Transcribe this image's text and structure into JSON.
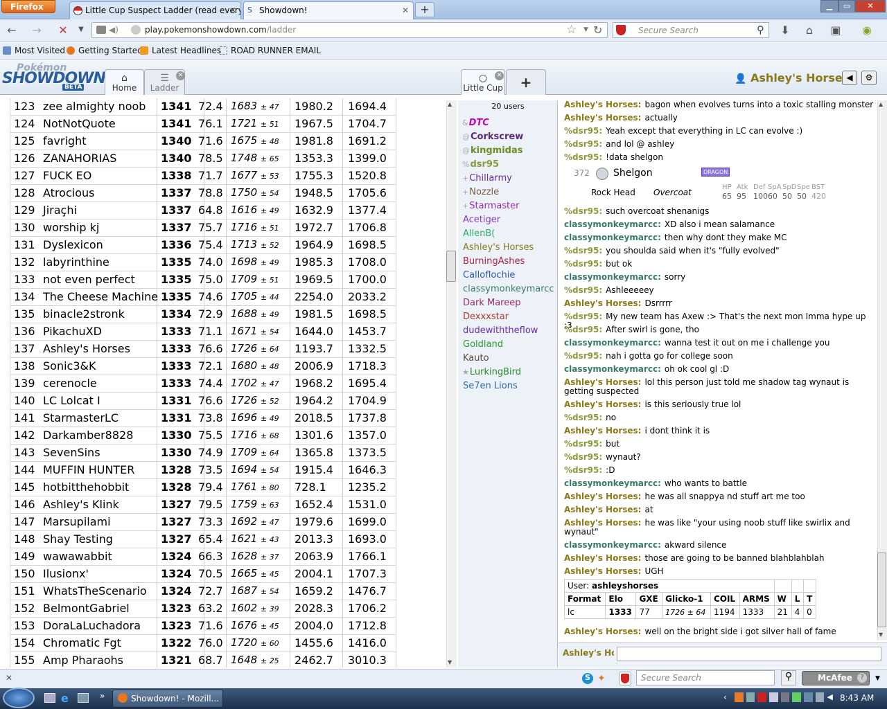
{
  "browser": {
    "menu": "Firefox",
    "tabs": [
      {
        "title": "Little Cup Suspect Ladder (read every..."
      },
      {
        "title": "Showdown!"
      }
    ],
    "url_domain": "play.pokemonshowdown.com",
    "url_path": "/ladder",
    "search_placeholder": "Secure Search",
    "bookmarks": [
      "Most Visited",
      "Getting Started",
      "Latest Headlines",
      "ROAD RUNNER EMAIL"
    ],
    "addon_search_placeholder": "Secure Search",
    "addon_label": "McAfee"
  },
  "app": {
    "logo_top": "Pokémon",
    "logo_main": "SHOWDOWN",
    "logo_badge": "BETA",
    "tabs": [
      {
        "label": "Home"
      },
      {
        "label": "Ladder"
      },
      {
        "label": "Little Cup"
      }
    ],
    "add_tab": "+",
    "username": "Ashley's Horses"
  },
  "ladder": {
    "rows": [
      [
        "123",
        "zee almighty noob",
        "1341",
        "72.4",
        "1683",
        "47",
        "1980.2",
        "1694.4"
      ],
      [
        "124",
        "NotNotQuote",
        "1341",
        "76.1",
        "1721",
        "51",
        "1967.5",
        "1704.7"
      ],
      [
        "125",
        "favright",
        "1340",
        "71.6",
        "1675",
        "48",
        "1981.8",
        "1691.2"
      ],
      [
        "126",
        "ZANAHORIAS",
        "1340",
        "78.5",
        "1748",
        "65",
        "1353.3",
        "1399.0"
      ],
      [
        "127",
        "FUCK EO",
        "1338",
        "71.7",
        "1677",
        "53",
        "1755.3",
        "1520.8"
      ],
      [
        "128",
        "Atrocious",
        "1337",
        "78.8",
        "1750",
        "54",
        "1948.5",
        "1705.6"
      ],
      [
        "129",
        "Jiraçhi",
        "1337",
        "64.8",
        "1616",
        "49",
        "1632.9",
        "1377.4"
      ],
      [
        "130",
        "worship kj",
        "1337",
        "75.7",
        "1716",
        "51",
        "1972.7",
        "1706.8"
      ],
      [
        "131",
        "Dyslexicon",
        "1336",
        "75.4",
        "1713",
        "52",
        "1964.9",
        "1698.5"
      ],
      [
        "132",
        "labyrinthine",
        "1335",
        "74.0",
        "1698",
        "49",
        "1985.3",
        "1708.0"
      ],
      [
        "133",
        "not even perfect",
        "1335",
        "75.0",
        "1709",
        "51",
        "1969.5",
        "1700.0"
      ],
      [
        "134",
        "The Cheese Machine",
        "1335",
        "74.6",
        "1705",
        "44",
        "2254.0",
        "2033.2"
      ],
      [
        "135",
        "binacle2stronk",
        "1334",
        "72.9",
        "1688",
        "49",
        "1981.5",
        "1698.5"
      ],
      [
        "136",
        "PikachuXD",
        "1333",
        "71.1",
        "1671",
        "54",
        "1644.0",
        "1453.7"
      ],
      [
        "137",
        "Ashley's Horses",
        "1333",
        "76.6",
        "1726",
        "64",
        "1193.7",
        "1332.5"
      ],
      [
        "138",
        "Sonic3&K",
        "1333",
        "72.1",
        "1680",
        "48",
        "2006.9",
        "1718.3"
      ],
      [
        "139",
        "cerenocle",
        "1333",
        "74.4",
        "1702",
        "47",
        "1968.2",
        "1695.4"
      ],
      [
        "140",
        "LC Lolcat I",
        "1331",
        "76.6",
        "1726",
        "52",
        "1964.2",
        "1704.9"
      ],
      [
        "141",
        "StarmasterLC",
        "1331",
        "73.8",
        "1696",
        "49",
        "2018.5",
        "1737.8"
      ],
      [
        "142",
        "Darkamber8828",
        "1330",
        "75.5",
        "1716",
        "68",
        "1301.6",
        "1357.0"
      ],
      [
        "143",
        "SevenSins",
        "1330",
        "74.9",
        "1709",
        "64",
        "1365.8",
        "1373.5"
      ],
      [
        "144",
        "MUFFIN HUNTER",
        "1328",
        "73.5",
        "1694",
        "54",
        "1915.4",
        "1646.3"
      ],
      [
        "145",
        "hotbitthehobbit",
        "1328",
        "79.4",
        "1761",
        "80",
        "728.1",
        "1235.2"
      ],
      [
        "146",
        "Ashley's Klink",
        "1327",
        "79.5",
        "1759",
        "63",
        "1652.4",
        "1531.0"
      ],
      [
        "147",
        "Marsupilami",
        "1327",
        "73.3",
        "1692",
        "47",
        "1979.6",
        "1699.0"
      ],
      [
        "148",
        "Shay Testing",
        "1327",
        "65.4",
        "1621",
        "43",
        "2013.3",
        "1693.0"
      ],
      [
        "149",
        "wawawabbit",
        "1324",
        "66.3",
        "1628",
        "37",
        "2063.9",
        "1766.1"
      ],
      [
        "150",
        "Ilusionx'",
        "1324",
        "70.5",
        "1665",
        "45",
        "2004.1",
        "1707.3"
      ],
      [
        "151",
        "WhatsTheScenario",
        "1324",
        "72.7",
        "1687",
        "54",
        "1659.2",
        "1476.7"
      ],
      [
        "152",
        "BelmontGabriel",
        "1323",
        "63.2",
        "1602",
        "39",
        "2028.3",
        "1706.2"
      ],
      [
        "153",
        "DoraLaLuchadora",
        "1323",
        "71.6",
        "1676",
        "45",
        "2004.0",
        "1712.8"
      ],
      [
        "154",
        "Chromatic Fgt",
        "1322",
        "76.0",
        "1720",
        "60",
        "1455.6",
        "1416.0"
      ],
      [
        "155",
        "Amp Pharaohs",
        "1321",
        "68.7",
        "1648",
        "25",
        "2462.7",
        "3010.3"
      ]
    ],
    "pm": "±"
  },
  "userlist": {
    "count": "20 users",
    "users": [
      {
        "sym": "&",
        "name": "DTC",
        "color": "#c800c8",
        "style": "bi"
      },
      {
        "sym": "@",
        "name": "Corkscrew",
        "color": "#5a2a7a",
        "style": "b"
      },
      {
        "sym": "@",
        "name": "kingmidas",
        "color": "#6b8e23",
        "style": "b"
      },
      {
        "sym": "%",
        "name": "dsr95",
        "color": "#8a9a3a",
        "style": "b"
      },
      {
        "sym": "+",
        "name": "Chillarmy",
        "color": "#6a2a9a",
        "style": ""
      },
      {
        "sym": "+",
        "name": "Nozzle",
        "color": "#7a5a3a",
        "style": ""
      },
      {
        "sym": "+",
        "name": "Starmaster",
        "color": "#9a2ab0",
        "style": ""
      },
      {
        "sym": "",
        "name": "Acetiger",
        "color": "#8a3ac0",
        "style": ""
      },
      {
        "sym": "",
        "name": "AllenB(",
        "color": "#2ab06a",
        "style": ""
      },
      {
        "sym": "",
        "name": "Ashley's Horses",
        "color": "#8c7a1a",
        "style": ""
      },
      {
        "sym": "",
        "name": "BurningAshes",
        "color": "#b0204a",
        "style": ""
      },
      {
        "sym": "",
        "name": "Calloflochie",
        "color": "#2a5ab0",
        "style": ""
      },
      {
        "sym": "",
        "name": "classymonkeymarcc",
        "color": "#3a7a6a",
        "style": ""
      },
      {
        "sym": "",
        "name": "Dark Mareep",
        "color": "#9a2a6a",
        "style": ""
      },
      {
        "sym": "",
        "name": "Dexxxstar",
        "color": "#b03a2a",
        "style": ""
      },
      {
        "sym": "",
        "name": "dudewiththeflow",
        "color": "#6a2ab0",
        "style": ""
      },
      {
        "sym": "",
        "name": "Goldland",
        "color": "#2a9a2a",
        "style": ""
      },
      {
        "sym": "",
        "name": "Kauto",
        "color": "#5a4a3a",
        "style": ""
      },
      {
        "sym": "★",
        "name": "LurkingBird",
        "color": "#2a8a2a",
        "style": ""
      },
      {
        "sym": "",
        "name": "Se7en Lions",
        "color": "#2a6ab0",
        "style": ""
      }
    ]
  },
  "chat": {
    "messages": [
      {
        "name": "Ashley's Horses:",
        "text": "bagon when evolves turns into a toxic stalling monster",
        "color": "#8c7a1a"
      },
      {
        "name": "Ashley's Horses:",
        "text": "actually",
        "color": "#8c7a1a"
      },
      {
        "name": "%dsr95:",
        "text": "Yeah except that everything in LC can evolve :)",
        "color": "#8a9a3a"
      },
      {
        "name": "%dsr95:",
        "text": "and lol @ ashley",
        "color": "#8a9a3a"
      },
      {
        "name": "%dsr95:",
        "text": "!data shelgon",
        "color": "#8a9a3a"
      },
      {
        "name": "%dsr95:",
        "text": "such overcoat shenanigs",
        "color": "#8a9a3a"
      },
      {
        "name": "classymonkeymarcc:",
        "text": "XD also i mean salamance",
        "color": "#3a7a6a"
      },
      {
        "name": "classymonkeymarcc:",
        "text": "then why dont they make MC",
        "color": "#3a7a6a"
      },
      {
        "name": "%dsr95:",
        "text": "you shoulda said when it's \"fully evolved\"",
        "color": "#8a9a3a"
      },
      {
        "name": "%dsr95:",
        "text": "but ok",
        "color": "#8a9a3a"
      },
      {
        "name": "classymonkeymarcc:",
        "text": "sorry",
        "color": "#3a7a6a"
      },
      {
        "name": "%dsr95:",
        "text": "Ashleeeeey",
        "color": "#8a9a3a"
      },
      {
        "name": "Ashley's Horses:",
        "text": "Dsrrrrr",
        "color": "#8c7a1a"
      },
      {
        "name": "%dsr95:",
        "text": "My new team has Axew :> That's the next mon Imma hype up :3",
        "color": "#8a9a3a"
      },
      {
        "name": "%dsr95:",
        "text": "After swirl is gone, tho",
        "color": "#8a9a3a"
      },
      {
        "name": "classymonkeymarcc:",
        "text": "wanna test it out on me i challenge you",
        "color": "#3a7a6a"
      },
      {
        "name": "%dsr95:",
        "text": "nah i gotta go for college soon",
        "color": "#8a9a3a"
      },
      {
        "name": "classymonkeymarcc:",
        "text": "oh ok cool gl :D",
        "color": "#3a7a6a"
      },
      {
        "name": "Ashley's Horses:",
        "text": "lol this person just told me shadow tag wynaut is getting suspected",
        "color": "#8c7a1a"
      },
      {
        "name": "Ashley's Horses:",
        "text": "is this seriously true lol",
        "color": "#8c7a1a"
      },
      {
        "name": "%dsr95:",
        "text": "no",
        "color": "#8a9a3a"
      },
      {
        "name": "Ashley's Horses:",
        "text": "i dont think it is",
        "color": "#8c7a1a"
      },
      {
        "name": "%dsr95:",
        "text": "but",
        "color": "#8a9a3a"
      },
      {
        "name": "%dsr95:",
        "text": "wynaut?",
        "color": "#8a9a3a"
      },
      {
        "name": "%dsr95:",
        "text": ":D",
        "color": "#8a9a3a"
      },
      {
        "name": "classymonkeymarcc:",
        "text": "who wants to battle",
        "color": "#3a7a6a"
      },
      {
        "name": "Ashley's Horses:",
        "text": "he was all snappya nd stuff art me too",
        "color": "#8c7a1a"
      },
      {
        "name": "Ashley's Horses:",
        "text": "at",
        "color": "#8c7a1a"
      },
      {
        "name": "Ashley's Horses:",
        "text": "he was like \"your using noob stuff like swirlix and wynaut\"",
        "color": "#8c7a1a"
      },
      {
        "name": "classymonkeymarcc:",
        "text": "akward silence",
        "color": "#3a7a6a"
      },
      {
        "name": "Ashley's Horses:",
        "text": "those are going to be banned blahblahblah",
        "color": "#8c7a1a"
      },
      {
        "name": "Ashley's Horses:",
        "text": "UGH",
        "color": "#8c7a1a"
      },
      {
        "name": "Ashley's Horses:",
        "text": "well on the bright side i got silver hall of fame",
        "color": "#8c7a1a"
      }
    ],
    "datacard": {
      "num": "372",
      "pokemon": "Shelgon",
      "type": "DRAGON",
      "ability": "Rock Head",
      "ability2": "Overcoat",
      "stat_labels": [
        "HP",
        "Atk",
        "Def",
        "SpA",
        "SpD",
        "Spe",
        "BST"
      ],
      "stat_values": [
        "65",
        "95",
        "100",
        "60",
        "50",
        "50",
        "420"
      ]
    },
    "userinfo": {
      "label": "User:",
      "user": "ashleyshorses",
      "headers": [
        "Format",
        "Elo",
        "GXE",
        "Glicko-1",
        "COIL",
        "ARMS",
        "W",
        "L",
        "T"
      ],
      "values": [
        "lc",
        "1333",
        "77",
        "1726 ± 64",
        "1194",
        "1333",
        "21",
        "4",
        "0"
      ]
    },
    "input_name": "Ashley's Horses"
  },
  "taskbar": {
    "item": "Showdown! - Mozill...",
    "clock": "8:43 AM"
  }
}
